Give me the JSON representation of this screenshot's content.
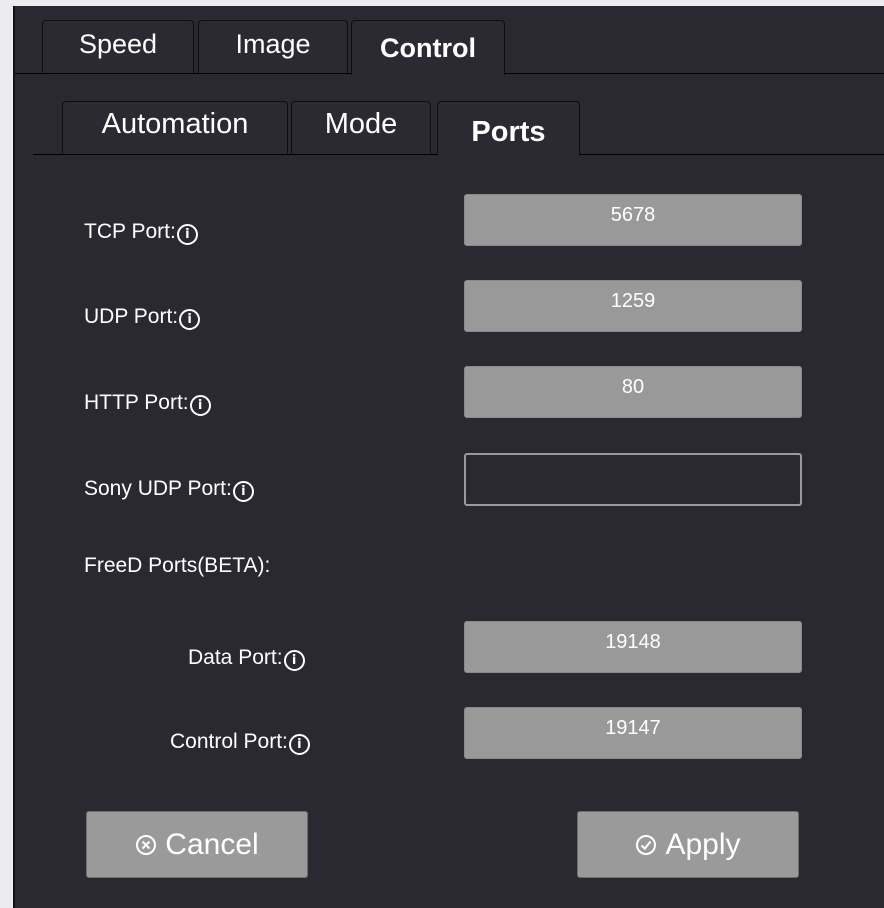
{
  "top_tabs": [
    {
      "label": "Speed",
      "active": false
    },
    {
      "label": "Image",
      "active": false
    },
    {
      "label": "Control",
      "active": true
    }
  ],
  "sub_tabs": [
    {
      "label": "Automation",
      "active": false
    },
    {
      "label": "Mode",
      "active": false
    },
    {
      "label": "Ports",
      "active": true
    }
  ],
  "ports": {
    "tcp": {
      "label": "TCP Port:",
      "value": "5678"
    },
    "udp": {
      "label": "UDP Port:",
      "value": "1259"
    },
    "http": {
      "label": "HTTP Port:",
      "value": "80"
    },
    "sony_udp": {
      "label": "Sony UDP Port:",
      "value": ""
    },
    "freed_heading": "FreeD Ports(BETA):",
    "freed_data": {
      "label": "Data Port:",
      "value": "19148"
    },
    "freed_control": {
      "label": "Control Port:",
      "value": "19147"
    }
  },
  "actions": {
    "cancel_label": "Cancel",
    "apply_label": "Apply"
  },
  "info_glyph": "i",
  "colors": {
    "panel_bg": "#2a2830",
    "field_bg": "#999999",
    "page_bg": "#ececee"
  }
}
